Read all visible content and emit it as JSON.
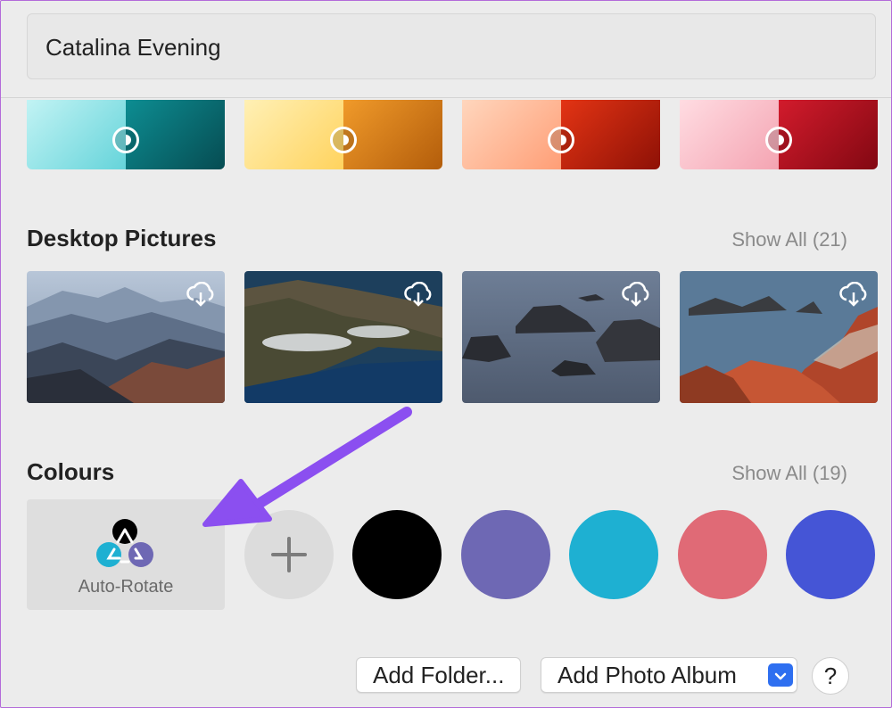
{
  "header": {
    "title": "Catalina Evening"
  },
  "dynamic_wallpapers": [
    {
      "left_color": "#8fe3e6",
      "right_color": "#0a6e73"
    },
    {
      "left_color": "#ffe18a",
      "right_color": "#d97812"
    },
    {
      "left_color": "#ffc2a0",
      "right_color": "#c0200e"
    },
    {
      "left_color": "#ffc6cf",
      "right_color": "#b8101e"
    }
  ],
  "desktop_pictures": {
    "title": "Desktop Pictures",
    "show_all": "Show All (21)",
    "download_icon": "cloud-download-icon"
  },
  "colours": {
    "title": "Colours",
    "show_all": "Show All (19)",
    "auto_rotate_label": "Auto-Rotate",
    "add_icon": "plus-icon",
    "swatches": [
      "#000000",
      "#6e68b4",
      "#1eb0d2",
      "#e06a76",
      "#4555d6"
    ]
  },
  "footer": {
    "add_folder": "Add Folder...",
    "add_photo_album": "Add Photo Album",
    "help": "?"
  },
  "annotation": {
    "arrow_color": "#8b4ff0"
  }
}
